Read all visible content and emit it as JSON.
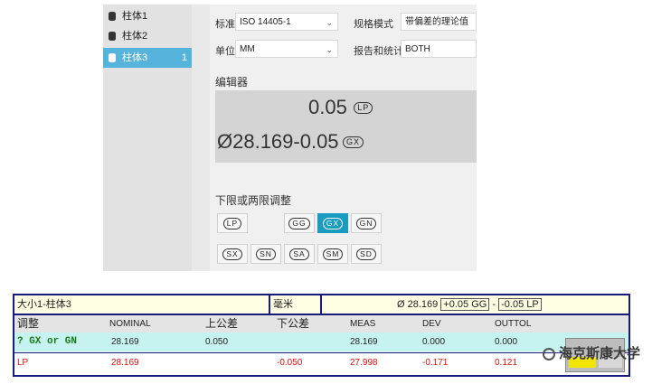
{
  "sidebar": {
    "items": [
      {
        "label": "柱体1",
        "count": ""
      },
      {
        "label": "柱体2",
        "count": ""
      },
      {
        "label": "柱体3",
        "count": "1"
      }
    ]
  },
  "form": {
    "standard_label": "标准",
    "standard_value": "ISO 14405-1",
    "spec_mode_label": "规格模式",
    "spec_mode_value": "带偏差的理论值",
    "unit_label": "单位",
    "unit_value": "MM",
    "report_label": "报告和统计",
    "report_value": "BOTH",
    "editor_label": "编辑器",
    "editor_top_value": "0.05",
    "editor_top_modifier": "LP",
    "editor_main_value": "Ø28.169-0.05",
    "editor_main_modifier": "GX",
    "adjust_label": "下限或两限调整",
    "row1_buttons": [
      "LP",
      "GG",
      "GX",
      "GN"
    ],
    "row2_buttons": [
      "SX",
      "SN",
      "SA",
      "SM",
      "SD"
    ],
    "selected_button": "GX"
  },
  "report": {
    "title": "大小1-柱体3",
    "unit": "毫米",
    "spec_diameter": "Ø 28.169",
    "spec_upper": "+0.05 GG",
    "spec_sep": "-",
    "spec_lower": "-0.05 LP",
    "columns": [
      "调整",
      "NOMINAL",
      "上公差",
      "下公差",
      "MEAS",
      "DEV",
      "OUTTOL"
    ],
    "rows": [
      {
        "adjust": "? GX or GN",
        "nominal": "28.169",
        "upper": "0.050",
        "lower": "",
        "meas": "28.169",
        "dev": "0.000",
        "outtol": "0.000"
      },
      {
        "adjust": "LP",
        "nominal": "28.169",
        "upper": "",
        "lower": "-0.050",
        "meas": "27.998",
        "dev": "-0.171",
        "outtol": "0.121"
      }
    ]
  },
  "watermark": "海克斯康大学",
  "colors": {
    "accent": "#1a9bc1",
    "selected_item": "#56b3dc",
    "table_border": "#1a1a7a",
    "row_highlight": "#c6f3f0",
    "error": "#d11111"
  }
}
